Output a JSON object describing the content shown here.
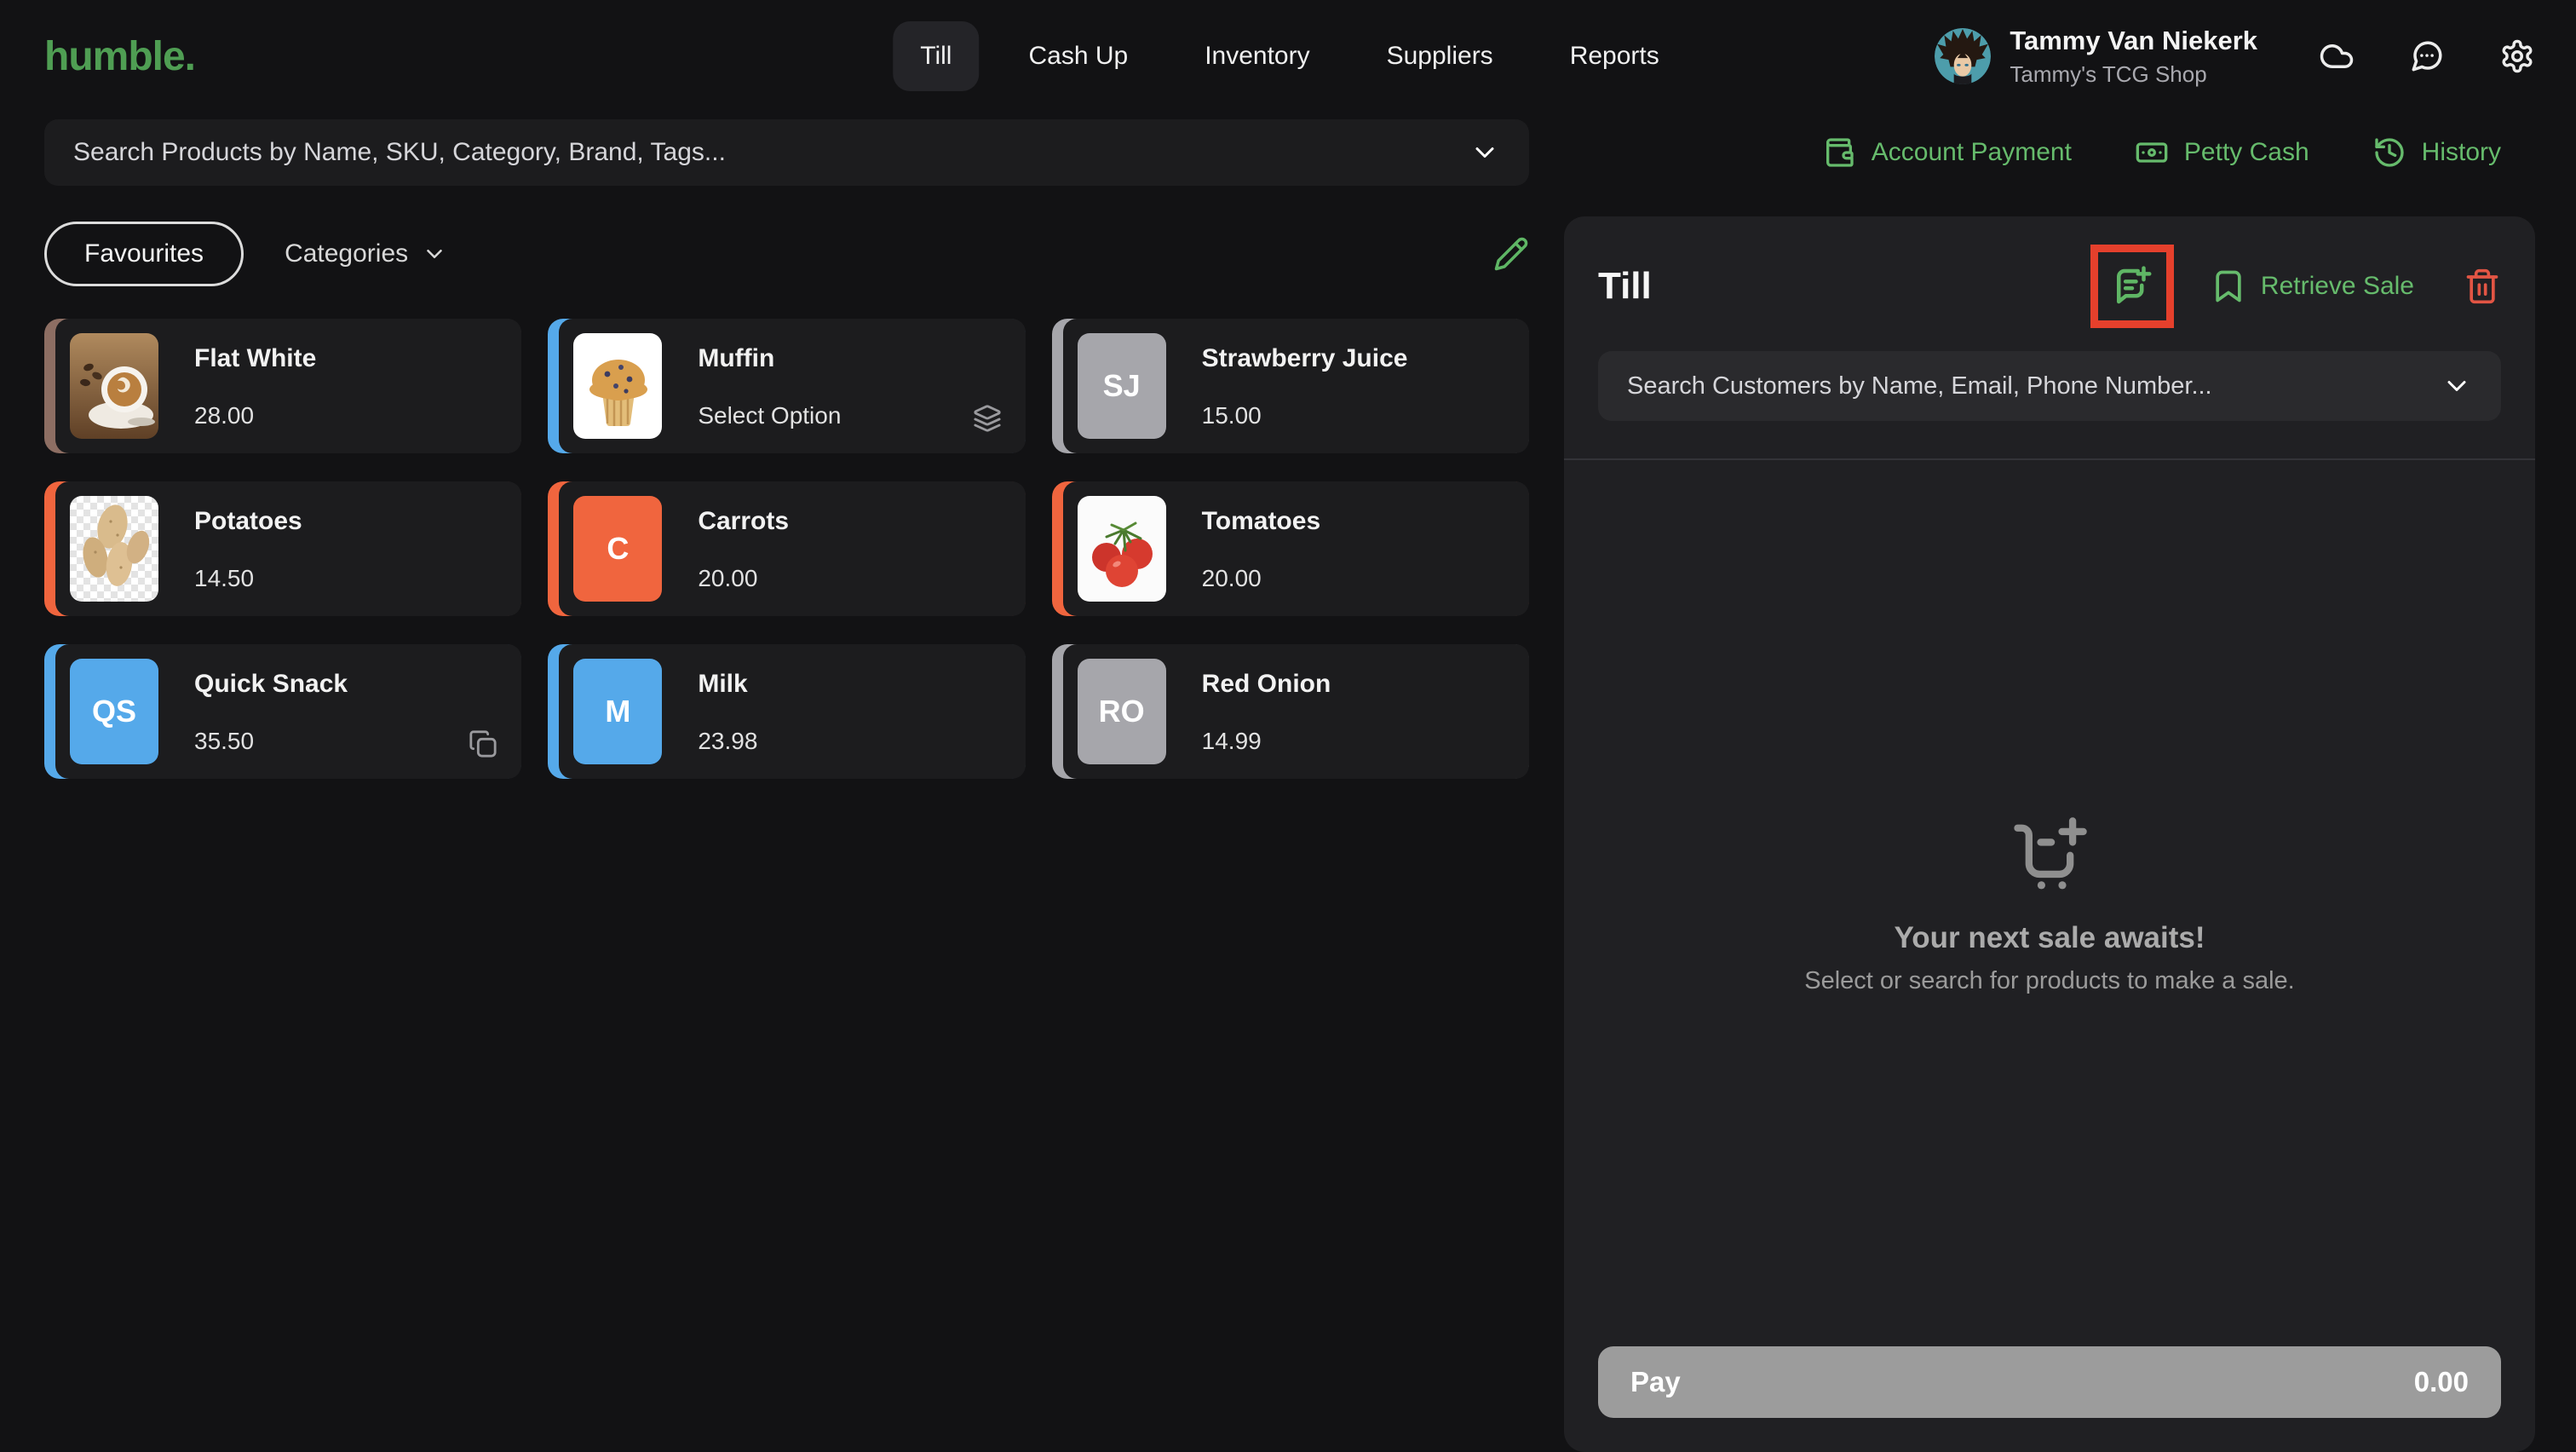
{
  "app": {
    "logo": "humble.",
    "logo_color": "#4f9e53",
    "accent_green": "#66bb6c",
    "annotation_color": "#e5402c"
  },
  "nav": {
    "items": [
      "Till",
      "Cash Up",
      "Inventory",
      "Suppliers",
      "Reports"
    ],
    "active": "Till"
  },
  "user": {
    "name": "Tammy Van Niekerk",
    "store": "Tammy's TCG Shop",
    "avatar": "vegeta-cartoon-on-teal"
  },
  "topbar_icons": [
    {
      "name": "cloud-icon"
    },
    {
      "name": "chat-icon"
    },
    {
      "name": "gear-icon"
    }
  ],
  "product_search": {
    "placeholder": "Search Products by Name, SKU, Category, Brand, Tags..."
  },
  "quick_actions": [
    {
      "label": "Account Payment",
      "icon": "wallet-icon"
    },
    {
      "label": "Petty Cash",
      "icon": "banknote-icon"
    },
    {
      "label": "History",
      "icon": "history-icon"
    }
  ],
  "filters": {
    "favourites_label": "Favourites",
    "categories_label": "Categories",
    "edit_icon": "pencil-icon"
  },
  "products": [
    {
      "name": "Flat White",
      "bottom_label": "28.00",
      "accent": "#8d6e63",
      "tile": {
        "type": "art",
        "art": "coffee"
      }
    },
    {
      "name": "Muffin",
      "bottom_label": "Select Option",
      "accent": "#55a9ea",
      "tile": {
        "type": "art",
        "art": "muffin"
      },
      "corner_icon": "layers-icon"
    },
    {
      "name": "Strawberry Juice",
      "bottom_label": "15.00",
      "accent": "#a6a6ab",
      "tile": {
        "type": "initials",
        "initials": "SJ",
        "bg": "#a6a6ab"
      }
    },
    {
      "name": "Potatoes",
      "bottom_label": "14.50",
      "accent": "#f0653e",
      "tile": {
        "type": "art",
        "art": "potatoes"
      }
    },
    {
      "name": "Carrots",
      "bottom_label": "20.00",
      "accent": "#f0653e",
      "tile": {
        "type": "initials",
        "initials": "C",
        "bg": "#f0653e"
      }
    },
    {
      "name": "Tomatoes",
      "bottom_label": "20.00",
      "accent": "#f0653e",
      "tile": {
        "type": "art",
        "art": "tomatoes"
      }
    },
    {
      "name": "Quick Snack",
      "bottom_label": "35.50",
      "accent": "#55a9ea",
      "tile": {
        "type": "initials",
        "initials": "QS",
        "bg": "#55a9ea"
      },
      "corner_icon": "copy-icon"
    },
    {
      "name": "Milk",
      "bottom_label": "23.98",
      "accent": "#55a9ea",
      "tile": {
        "type": "initials",
        "initials": "M",
        "bg": "#55a9ea"
      }
    },
    {
      "name": "Red Onion",
      "bottom_label": "14.99",
      "accent": "#a6a6ab",
      "tile": {
        "type": "initials",
        "initials": "RO",
        "bg": "#a6a6ab"
      }
    }
  ],
  "till_panel": {
    "title": "Till",
    "add_note_icon": "add-note-icon",
    "retrieve_sale_label": "Retrieve Sale",
    "trash_icon": "trash-icon",
    "customer_search_placeholder": "Search Customers by Name, Email, Phone Number...",
    "empty_state": {
      "icon": "cart-plus-icon",
      "title": "Your next sale awaits!",
      "subtitle": "Select or search for products to make a sale."
    },
    "pay_label": "Pay",
    "pay_amount": "0.00"
  }
}
